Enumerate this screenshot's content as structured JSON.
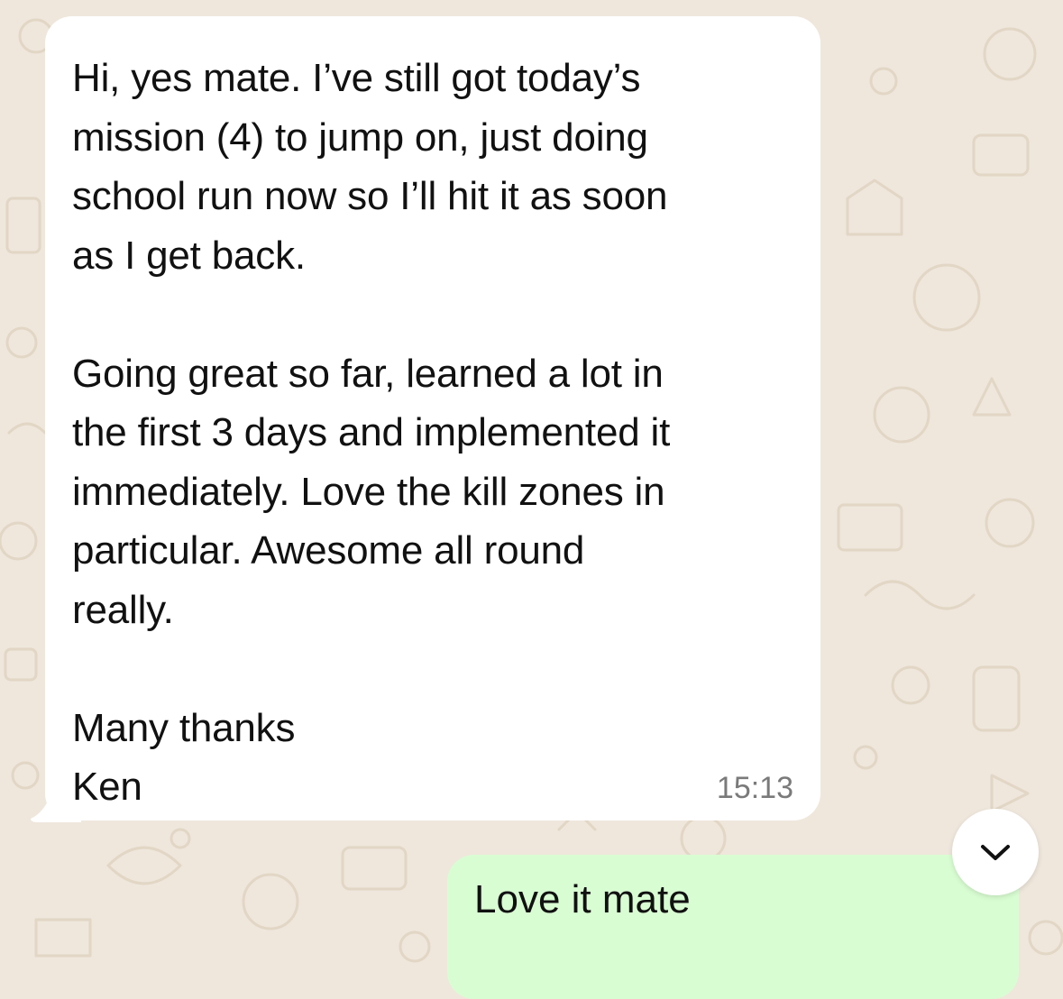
{
  "incoming": {
    "paragraphs": [
      "Hi, yes mate. I’ve still got today’s\nmission (4) to jump on, just doing\nschool run now so I’ll hit it as soon\nas I get back.",
      "Going great so far, learned a lot in\nthe first 3 days and implemented it\nimmediately. Love the kill zones in\nparticular. Awesome all round\nreally.",
      "Many thanks\nKen"
    ],
    "time": "15:13"
  },
  "outgoing": {
    "text": "Love it mate"
  },
  "scroll_button": {
    "icon": "chevron-down-icon"
  },
  "colors": {
    "wallpaper": "#efe7dc",
    "doodle": "#e2d6c5",
    "incoming_bubble": "#ffffff",
    "outgoing_bubble": "#d9fdd3",
    "timestamp": "#7a7a7a"
  }
}
